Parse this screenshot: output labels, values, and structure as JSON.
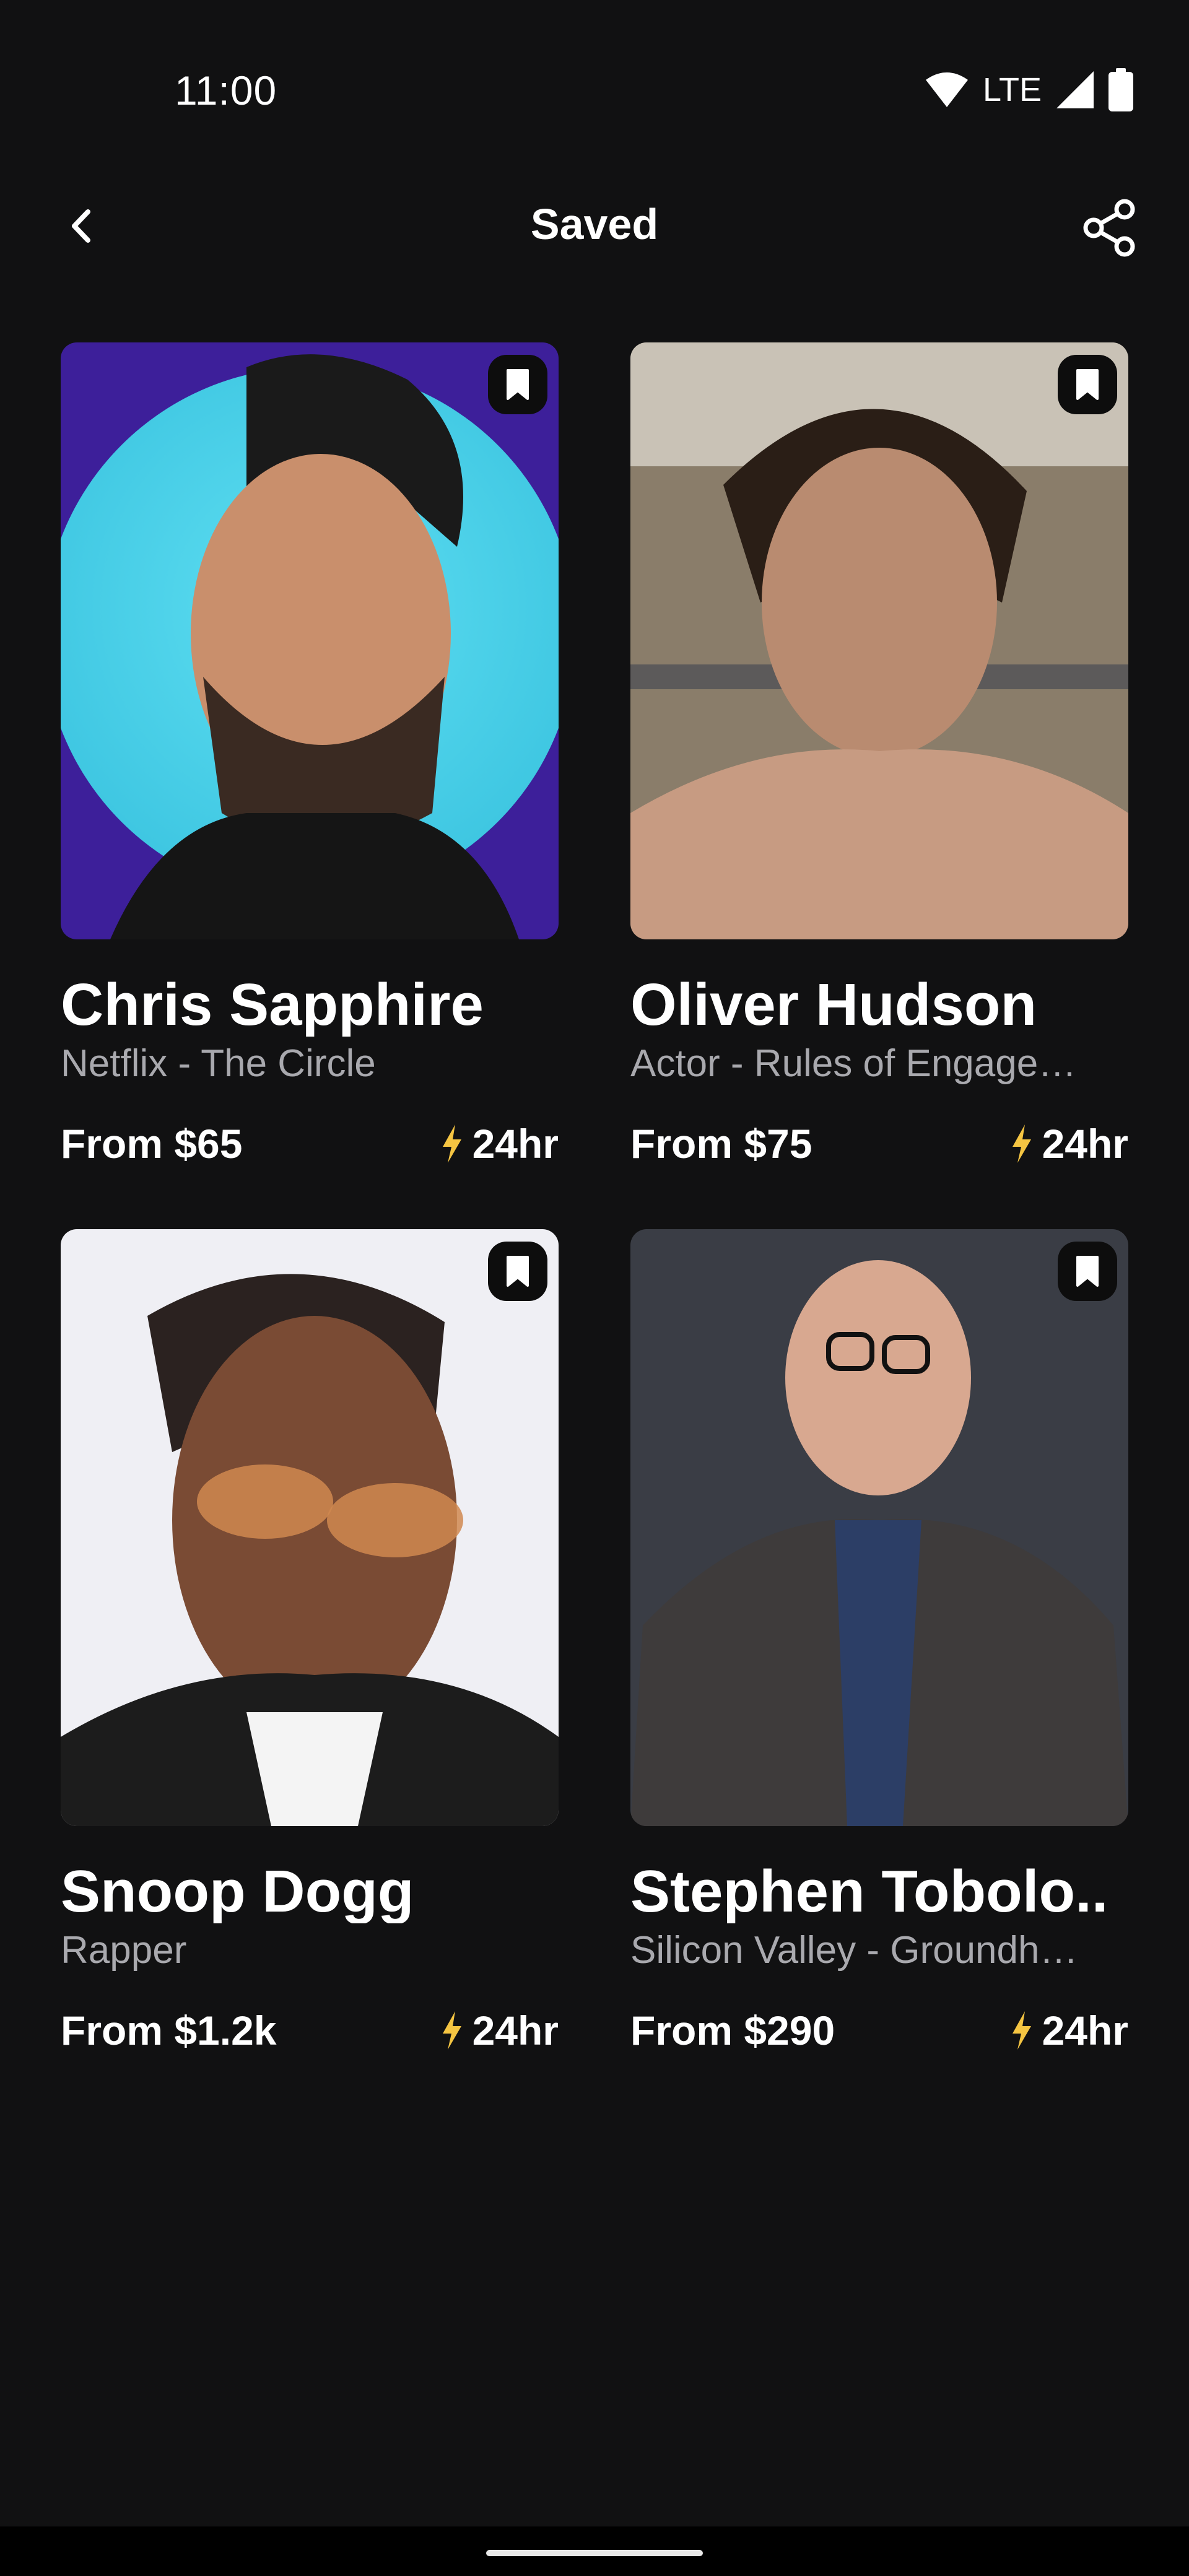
{
  "status_bar": {
    "time": "11:00",
    "network": "LTE",
    "icons": [
      "wifi-icon",
      "signal-icon",
      "battery-icon"
    ]
  },
  "header": {
    "title": "Saved",
    "back_icon": "chevron-left-icon",
    "share_icon": "share-icon"
  },
  "colors": {
    "background": "#111112",
    "text": "#ffffff",
    "subtitle": "#a9a9ae",
    "accent_bolt": "#f5c542"
  },
  "cards": [
    {
      "name": "Chris Sapphire",
      "subtitle": "Netflix - The Circle",
      "price": "From $65",
      "eta": "24hr"
    },
    {
      "name": "Oliver Hudson",
      "subtitle": "Actor - Rules of Engage…",
      "price": "From $75",
      "eta": "24hr"
    },
    {
      "name": "Snoop Dogg",
      "subtitle": "Rapper",
      "price": "From $1.2k",
      "eta": "24hr"
    },
    {
      "name": "Stephen Tobolo..",
      "subtitle": "Silicon Valley - Groundh…",
      "price": "From $290",
      "eta": "24hr"
    }
  ]
}
